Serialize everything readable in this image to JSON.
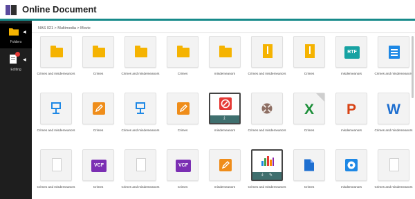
{
  "app": {
    "title": "Online Document"
  },
  "sidebar": {
    "items": [
      {
        "label": "Folders",
        "icon": "folder-icon"
      },
      {
        "label": "Editing",
        "icon": "document-edit-icon"
      }
    ]
  },
  "breadcrumb": "NAS 021 > Multimedia > Movie",
  "files": [
    {
      "name": "Crimes and misdemeanors",
      "type": "folder"
    },
    {
      "name": "Crimes",
      "type": "folder"
    },
    {
      "name": "Crimes and misdemeanors",
      "type": "folder"
    },
    {
      "name": "Crimes",
      "type": "folder"
    },
    {
      "name": "misdemeanors",
      "type": "folder"
    },
    {
      "name": "Crimes and misdemeanors",
      "type": "archive"
    },
    {
      "name": "Crimes",
      "type": "archive"
    },
    {
      "name": "misdemeanors",
      "type": "rtf",
      "badge": "RTF"
    },
    {
      "name": "Crimes and misdemeanors",
      "type": "document"
    },
    {
      "name": "Crimes and misdemeanors",
      "type": "keynote"
    },
    {
      "name": "Crimes",
      "type": "pages"
    },
    {
      "name": "Crimes and misdemeanors",
      "type": "keynote"
    },
    {
      "name": "Crimes",
      "type": "pages"
    },
    {
      "name": "misdemeanors",
      "type": "pdf"
    },
    {
      "name": "Crimes and misdemeanors",
      "type": "media"
    },
    {
      "name": "Crimes",
      "type": "excel",
      "badge": "X"
    },
    {
      "name": "misdemeanors",
      "type": "powerpoint",
      "badge": "P"
    },
    {
      "name": "Crimes and misdemeanors",
      "type": "word",
      "badge": "W"
    },
    {
      "name": "Crimes and misdemeanors",
      "type": "blank"
    },
    {
      "name": "Crimes",
      "type": "vcf",
      "badge": "VCF"
    },
    {
      "name": "Crimes and misdemeanors",
      "type": "blank"
    },
    {
      "name": "Crimes",
      "type": "vcf",
      "badge": "VCF"
    },
    {
      "name": "misdemeanors",
      "type": "pages"
    },
    {
      "name": "Crimes and misdemeanors",
      "type": "numbers"
    },
    {
      "name": "Crimes",
      "type": "google-doc"
    },
    {
      "name": "misdemeanors",
      "type": "disc"
    },
    {
      "name": "Crimes and misdemeanors",
      "type": "blank"
    }
  ],
  "colors": {
    "accent": "#178a8a",
    "folder": "#f5b301",
    "rtf": "#17a2a2",
    "vcf": "#7b2fb3",
    "pdf": "#e53935",
    "excel": "#1d8f3a",
    "powerpoint": "#d84315",
    "word": "#1e6fd0",
    "pages": "#ef8d1a"
  }
}
